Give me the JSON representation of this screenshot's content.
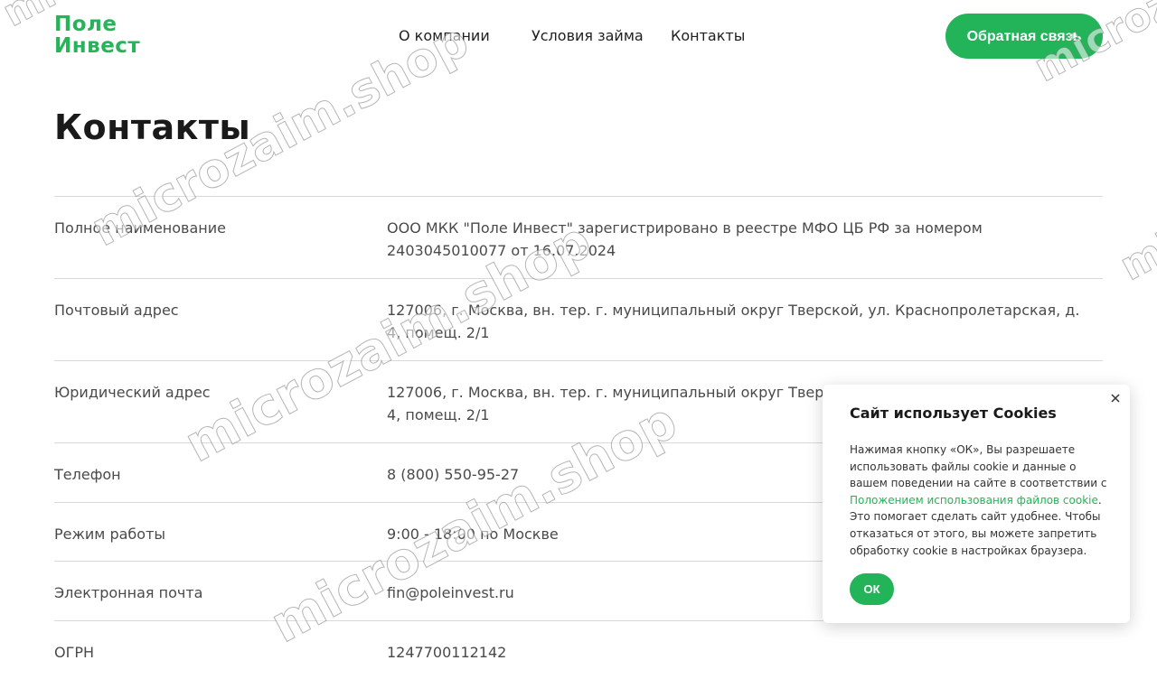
{
  "logo": {
    "line1": "Поле",
    "line2": "Инвест"
  },
  "nav": {
    "items": [
      "О компании",
      "Условия займа",
      "Контакты"
    ]
  },
  "header": {
    "feedback_label": "Обратная связь"
  },
  "page": {
    "title": "Контакты"
  },
  "contacts": {
    "rows": [
      {
        "label": "Полное наименование",
        "value": "ООО МКК \"Поле Инвест\" зарегистрировано в реестре МФО ЦБ РФ за номером 2403045010077 от 16.07.2024"
      },
      {
        "label": "Почтовый адрес",
        "value": "127006, г. Москва, вн. тер. г. муниципальный округ Тверской, ул. Краснопролетарская, д. 4, помещ. 2/1"
      },
      {
        "label": "Юридический адрес",
        "value": "127006, г. Москва, вн. тер. г. муниципальный округ Тверской, ул. Краснопролетарская, д. 4, помещ. 2/1"
      },
      {
        "label": "Телефон",
        "value": "8 (800) 550-95-27"
      },
      {
        "label": "Режим работы",
        "value": "9:00 - 18:00 по Москве"
      },
      {
        "label": "Электронная почта",
        "value": "fin@poleinvest.ru"
      },
      {
        "label": "ОГРН",
        "value": "1247700112142"
      }
    ]
  },
  "cookie": {
    "title": "Сайт использует Cookies",
    "text_before": "Нажимая кнопку «ОК», Вы разрешаете использовать файлы cookie и данные о вашем поведении на сайте в соответствии с ",
    "link": "Положением использования файлов cookie",
    "text_after": ". Это помогает сделать сайт удобнее. Чтобы отказаться от этого, вы можете запретить обработку cookie в настройках браузера.",
    "ok_label": "ОК"
  },
  "watermark": {
    "text": "microzaim.shop"
  },
  "colors": {
    "brand": "#23b45a",
    "text": "#1f1f1f",
    "muted": "#4a4a4a",
    "divider": "#d9d9d9"
  }
}
